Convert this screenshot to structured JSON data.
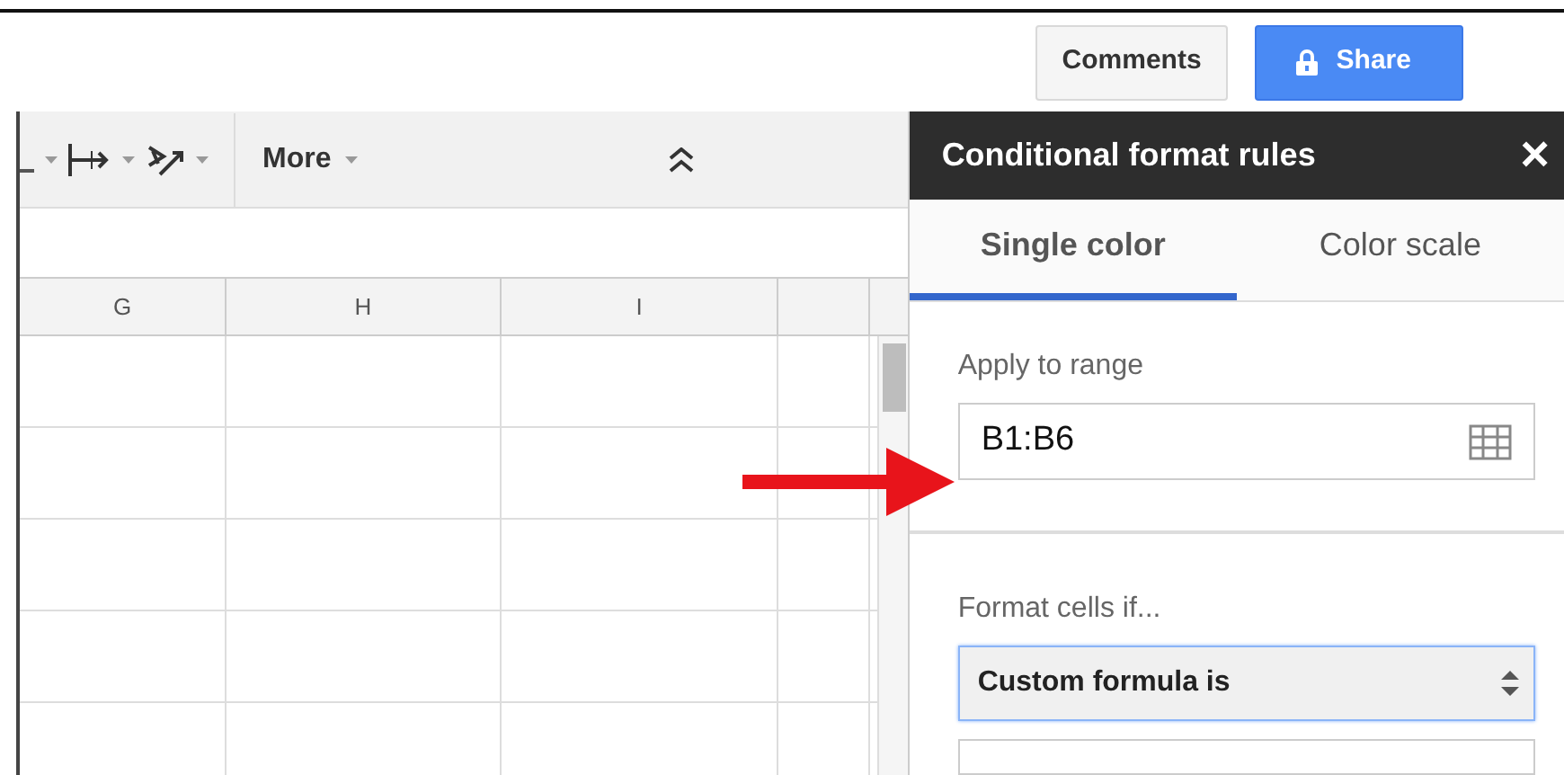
{
  "header": {
    "buttons": [
      {
        "label": "Comments",
        "kind": "default"
      },
      {
        "label": "Share",
        "kind": "primary"
      }
    ]
  },
  "toolbar": {
    "more": "More"
  },
  "sheet": {
    "columns": [
      "G",
      "H",
      "I"
    ]
  },
  "panel": {
    "title": "Conditional format rules",
    "close": "×",
    "tabs": [
      {
        "label": "Single color",
        "selected": true
      },
      {
        "label": "Color scale",
        "selected": false
      }
    ],
    "range_label": "Apply to range",
    "range_value": "B1:B6",
    "condition_label": "Format cells if...",
    "condition_value": "Custom formula is"
  }
}
